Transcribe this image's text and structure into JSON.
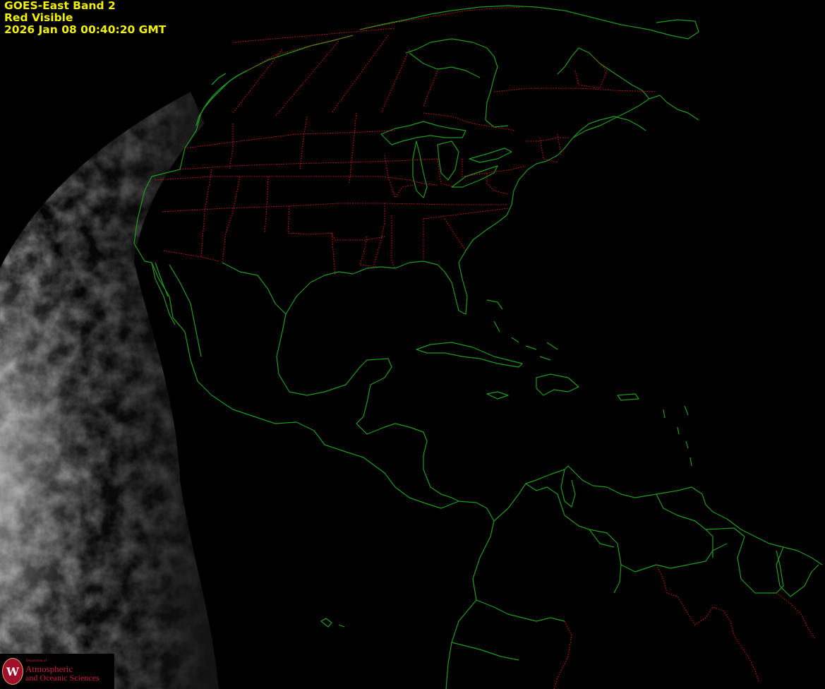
{
  "header": {
    "line1": "GOES-East Band 2",
    "line2": "Red Visible",
    "line3": "2026 Jan 08  00:40:20 GMT"
  },
  "logo": {
    "seal_letter": "W",
    "department": "Department of",
    "line1": "Atmospheric",
    "line2": "and Oceanic Sciences"
  },
  "colors": {
    "text": "#f2f200",
    "coastline": "#1e9b1e",
    "state_border": "#e01414",
    "background": "#000000"
  }
}
